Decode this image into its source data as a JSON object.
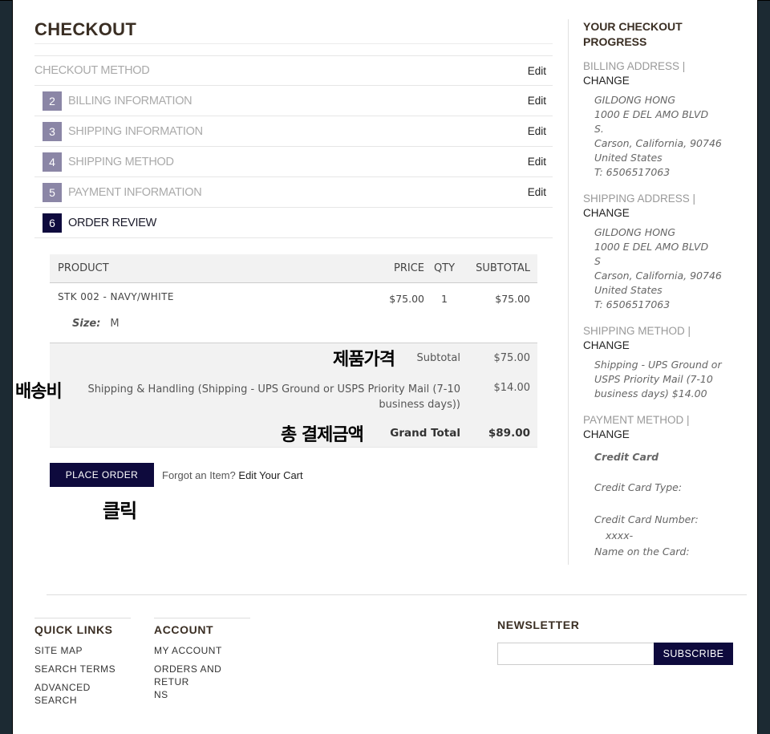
{
  "title": "CHECKOUT",
  "steps": [
    {
      "num": "",
      "label": "CHECKOUT METHOD",
      "edit": "Edit"
    },
    {
      "num": "2",
      "label": "BILLING INFORMATION",
      "edit": "Edit"
    },
    {
      "num": "3",
      "label": "SHIPPING INFORMATION",
      "edit": "Edit"
    },
    {
      "num": "4",
      "label": "SHIPPING METHOD",
      "edit": "Edit"
    },
    {
      "num": "5",
      "label": "PAYMENT INFORMATION",
      "edit": "Edit"
    },
    {
      "num": "6",
      "label": "ORDER REVIEW",
      "edit": ""
    }
  ],
  "review": {
    "headers": {
      "product": "PRODUCT",
      "price": "PRICE",
      "qty": "QTY",
      "subtotal": "SUBTOTAL"
    },
    "item": {
      "name": "STK 002 - NAVY/WHITE",
      "price": "$75.00",
      "qty": "1",
      "subtotal": "$75.00",
      "option_label": "Size:",
      "option_value": "M"
    },
    "totals": {
      "subtotal_label": "Subtotal",
      "subtotal": "$75.00",
      "shipping_label": "Shipping & Handling (Shipping - UPS Ground or USPS Priority Mail (7-10 business days))",
      "shipping": "$14.00",
      "grand_label": "Grand Total",
      "grand": "$89.00"
    }
  },
  "actions": {
    "place_order": "PLACE ORDER",
    "forgot_text": "Forgot an Item?",
    "edit_cart": "Edit Your Cart"
  },
  "annotations": {
    "product_price": "제품가격",
    "shipping_fee": "배송비",
    "total_payment": "총 결제금액",
    "click": "클릭"
  },
  "sidebar": {
    "title": "YOUR CHECKOUT PROGRESS",
    "billing": {
      "head": "BILLING ADDRESS |",
      "change": "CHANGE",
      "lines": [
        "GILDONG HONG",
        "1000 E DEL AMO BLVD",
        "S.",
        "Carson, California, 90746",
        "United States",
        "T: 6506517063"
      ]
    },
    "shipping": {
      "head": "SHIPPING ADDRESS |",
      "change": "CHANGE",
      "lines": [
        "GILDONG HONG",
        "1000 E DEL AMO BLVD",
        "S",
        "Carson, California, 90746",
        "United States",
        "T: 6506517063"
      ]
    },
    "method": {
      "head": "SHIPPING METHOD |",
      "change": "CHANGE",
      "lines": [
        "Shipping - UPS Ground or",
        "USPS Priority Mail (7-10",
        "business days) $14.00"
      ]
    },
    "payment": {
      "head": "PAYMENT METHOD |",
      "change": "CHANGE",
      "card": "Credit Card",
      "type_label": "Credit Card Type:",
      "number_label": "Credit Card Number:",
      "number_value": "xxxx-",
      "name_label": "Name on the Card:"
    }
  },
  "footer": {
    "quick_links": {
      "title": "QUICK LINKS",
      "items": [
        "SITE MAP",
        "SEARCH TERMS",
        "ADVANCED SEARCH"
      ]
    },
    "account": {
      "title": "ACCOUNT",
      "items": [
        "MY ACCOUNT",
        "ORDERS AND RETUR",
        "NS"
      ]
    },
    "newsletter": {
      "title": "NEWSLETTER",
      "subscribe": "SUBSCRIBE"
    }
  }
}
